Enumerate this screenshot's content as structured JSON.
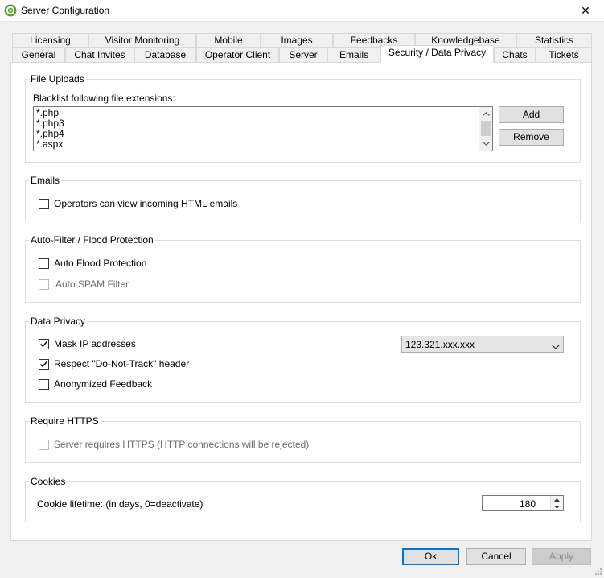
{
  "window": {
    "title": "Server Configuration",
    "close_glyph": "✕",
    "icon": "gear-icon"
  },
  "tabs": {
    "row_back": [
      "Licensing",
      "Visitor Monitoring",
      "Mobile",
      "Images",
      "Feedbacks",
      "Knowledgebase",
      "Statistics"
    ],
    "row_front": [
      "General",
      "Chat Invites",
      "Database",
      "Operator Client",
      "Server",
      "Emails",
      "Security / Data Privacy",
      "Chats",
      "Tickets"
    ],
    "active": "Security / Data Privacy"
  },
  "file_uploads": {
    "title": "File Uploads",
    "blacklist_label": "Blacklist following file extensions:",
    "extensions": [
      "*.php",
      "*.php3",
      "*.php4",
      "*.aspx"
    ],
    "add_label": "Add",
    "remove_label": "Remove"
  },
  "emails": {
    "title": "Emails",
    "view_html_label": "Operators can view incoming HTML emails",
    "view_html_checked": false
  },
  "auto_filter": {
    "title": "Auto-Filter / Flood Protection",
    "flood_label": "Auto Flood Protection",
    "flood_checked": false,
    "spam_label": "Auto SPAM Filter",
    "spam_checked": false,
    "spam_disabled": true
  },
  "data_privacy": {
    "title": "Data Privacy",
    "mask_ip_label": "Mask IP addresses",
    "mask_ip_checked": true,
    "mask_format": "123.321.xxx.xxx",
    "dnt_label": "Respect \"Do-Not-Track\" header",
    "dnt_checked": true,
    "anon_label": "Anonymized Feedback",
    "anon_checked": false
  },
  "https": {
    "title": "Require HTTPS",
    "require_label": "Server requires HTTPS (HTTP connections will be rejected)",
    "require_checked": false,
    "require_disabled": true
  },
  "cookies": {
    "title": "Cookies",
    "lifetime_label": "Cookie lifetime: (in days, 0=deactivate)",
    "lifetime_value": "180"
  },
  "footer": {
    "ok_label": "Ok",
    "cancel_label": "Cancel",
    "apply_label": "Apply"
  },
  "colors": {
    "accent": "#0078d7",
    "icon_green": "#5aa02c"
  }
}
